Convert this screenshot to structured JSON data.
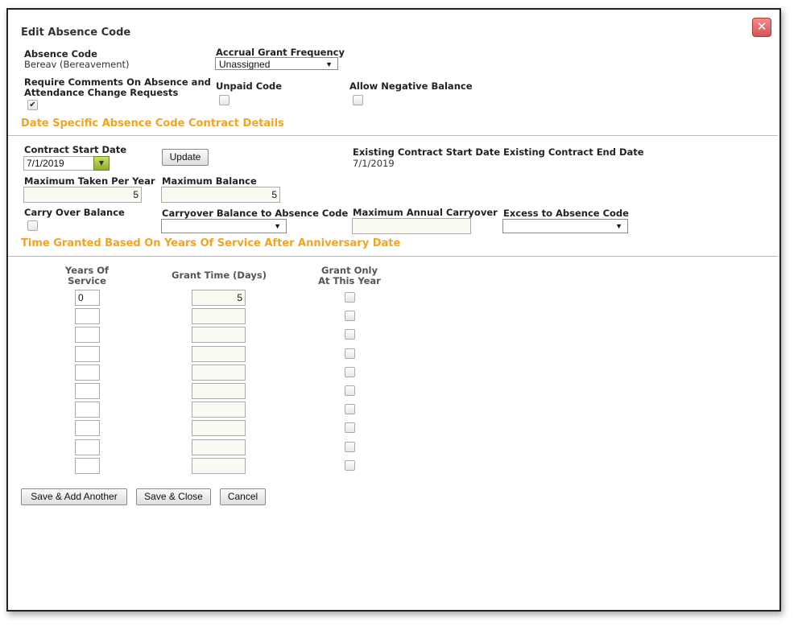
{
  "dialog": {
    "title": "Edit Absence Code",
    "close_glyph": "✕"
  },
  "absence_code": {
    "label": "Absence Code",
    "value": "Bereav (Bereavement)"
  },
  "accrual_grant_frequency": {
    "label": "Accrual Grant Frequency",
    "selected": "Unassigned"
  },
  "require_comments": {
    "label_line1": "Require Comments On Absence and",
    "label_line2": "Attendance Change Requests",
    "checked": true
  },
  "unpaid_code": {
    "label": "Unpaid Code",
    "checked": false
  },
  "allow_negative_balance": {
    "label": "Allow Negative Balance",
    "checked": false
  },
  "section_contract": {
    "title": "Date Specific Absence Code Contract Details"
  },
  "contract_start_date": {
    "label": "Contract Start Date",
    "value": "7/1/2019"
  },
  "update_button": {
    "label": "Update"
  },
  "existing_start": {
    "label": "Existing Contract Start Date",
    "value": "7/1/2019"
  },
  "existing_end": {
    "label": "Existing Contract End Date"
  },
  "max_taken_per_year": {
    "label": "Maximum Taken Per Year",
    "value": "5"
  },
  "max_balance": {
    "label": "Maximum Balance",
    "value": "5"
  },
  "carry_over_balance": {
    "label": "Carry Over Balance",
    "checked": false
  },
  "carryover_to_code": {
    "label": "Carryover Balance to Absence Code",
    "selected": ""
  },
  "max_annual_carryover": {
    "label": "Maximum Annual Carryover",
    "value": ""
  },
  "excess_to_code": {
    "label": "Excess to Absence Code",
    "selected": ""
  },
  "section_time_granted": {
    "title": "Time Granted Based On Years Of Service After Anniversary Date"
  },
  "grant_table": {
    "col_years_line1": "Years Of",
    "col_years_line2": "Service",
    "col_grant_time": "Grant Time (Days)",
    "col_grant_only_line1": "Grant Only",
    "col_grant_only_line2": "At This Year",
    "rows": [
      {
        "years": "0",
        "grant": "5"
      },
      {
        "years": "",
        "grant": ""
      },
      {
        "years": "",
        "grant": ""
      },
      {
        "years": "",
        "grant": ""
      },
      {
        "years": "",
        "grant": ""
      },
      {
        "years": "",
        "grant": ""
      },
      {
        "years": "",
        "grant": ""
      },
      {
        "years": "",
        "grant": ""
      },
      {
        "years": "",
        "grant": ""
      },
      {
        "years": "",
        "grant": ""
      }
    ]
  },
  "footer": {
    "save_add_label": "Save & Add Another",
    "save_close_label": "Save & Close",
    "cancel_label": "Cancel"
  },
  "colors": {
    "section_title": "#f5a31c",
    "close_button": "#d45353",
    "calendar_button": "#8cb02a"
  },
  "icons": {
    "close": "close-icon",
    "calendar": "calendar-icon",
    "dropdown": "chevron-down-icon",
    "check": "checkmark-icon"
  }
}
